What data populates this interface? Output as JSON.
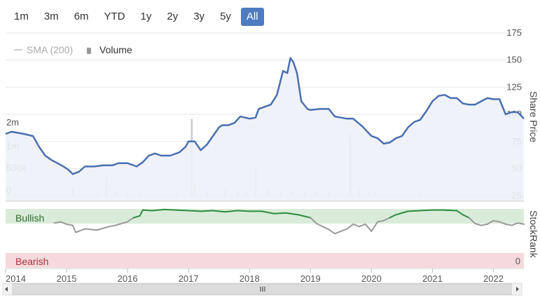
{
  "range_selector": {
    "buttons": [
      "1m",
      "3m",
      "6m",
      "YTD",
      "1y",
      "2y",
      "3y",
      "5y",
      "All"
    ],
    "active": "All"
  },
  "legend": {
    "sma_label": "SMA (200)",
    "volume_label": "Volume"
  },
  "colors": {
    "price_line": "#4a6fb0",
    "price_fill": "#eef1f8",
    "volume_bar": "#c9c9c9",
    "bullish_band": "#d9ecd9",
    "bearish_band": "#f5d9dc",
    "stockrank_green": "#2e8b3e",
    "stockrank_grey": "#9a9a9a",
    "active_button": "#4f7cc0"
  },
  "chart_data": {
    "type": "line",
    "x_axis": {
      "ticks": [
        "2014",
        "2015",
        "2016",
        "2017",
        "2018",
        "2019",
        "2020",
        "2021",
        "2022"
      ],
      "range": [
        2014.0,
        2022.5
      ]
    },
    "price_axis": {
      "label": "Share Price",
      "ticks": [
        25,
        50,
        75,
        100,
        125,
        150,
        175
      ],
      "range": [
        20,
        175
      ]
    },
    "volume_axis": {
      "ticks": [
        "0",
        "500k",
        "1m",
        "2m"
      ]
    },
    "stockrank_axis": {
      "label": "StockRank",
      "ticks": [
        "0"
      ]
    },
    "bands": {
      "bullish_label": "Bullish",
      "bearish_label": "Bearish"
    },
    "series": [
      {
        "kind": "price",
        "x": [
          2014.0,
          2014.1,
          2014.2,
          2014.3,
          2014.45,
          2014.55,
          2014.65,
          2014.75,
          2014.85,
          2014.95,
          2015.0,
          2015.05,
          2015.1,
          2015.2,
          2015.3,
          2015.45,
          2015.6,
          2015.75,
          2015.85,
          2016.0,
          2016.15,
          2016.25,
          2016.35,
          2016.45,
          2016.55,
          2016.7,
          2016.85,
          2016.95,
          2017.0,
          2017.1,
          2017.2,
          2017.3,
          2017.4,
          2017.5,
          2017.55,
          2017.65,
          2017.75,
          2017.85,
          2018.0,
          2018.1,
          2018.15,
          2018.25,
          2018.35,
          2018.45,
          2018.55,
          2018.62,
          2018.67,
          2018.72,
          2018.78,
          2018.85,
          2018.95,
          2019.0,
          2019.15,
          2019.3,
          2019.4,
          2019.5,
          2019.6,
          2019.7,
          2019.85,
          2020.0,
          2020.1,
          2020.2,
          2020.3,
          2020.4,
          2020.5,
          2020.6,
          2020.7,
          2020.8,
          2020.9,
          2021.0,
          2021.1,
          2021.2,
          2021.3,
          2021.4,
          2021.5,
          2021.6,
          2021.7,
          2021.8,
          2021.9,
          2022.0,
          2022.1,
          2022.2,
          2022.3,
          2022.4,
          2022.5
        ],
        "y": [
          82,
          84,
          83,
          82,
          80,
          70,
          62,
          58,
          55,
          52,
          50,
          48,
          45,
          47,
          52,
          52,
          53,
          53,
          55,
          55,
          52,
          56,
          62,
          64,
          62,
          62,
          65,
          70,
          75,
          75,
          67,
          72,
          80,
          88,
          90,
          90,
          92,
          98,
          96,
          97,
          105,
          107,
          109,
          118,
          140,
          138,
          152,
          148,
          138,
          112,
          105,
          104,
          105,
          105,
          98,
          97,
          96,
          96,
          89,
          80,
          78,
          73,
          74,
          78,
          80,
          88,
          93,
          95,
          103,
          112,
          117,
          118,
          115,
          115,
          110,
          109,
          109,
          112,
          115,
          114,
          114,
          100,
          102,
          102,
          96
        ]
      },
      {
        "kind": "volume",
        "x": [
          2014.05,
          2014.15,
          2014.3,
          2014.5,
          2014.7,
          2014.9,
          2015.1,
          2015.3,
          2015.5,
          2015.65,
          2015.8,
          2016.0,
          2016.2,
          2016.5,
          2016.8,
          2017.05,
          2017.1,
          2017.3,
          2017.6,
          2017.8,
          2017.95,
          2018.1,
          2018.3,
          2018.5,
          2018.7,
          2018.9,
          2019.1,
          2019.3,
          2019.5,
          2019.65,
          2019.8,
          2019.95,
          2020.05,
          2020.2,
          2020.4,
          2020.6,
          2020.8,
          2021.0,
          2021.2,
          2021.5,
          2021.8,
          2022.0,
          2022.2,
          2022.4
        ],
        "y": [
          120000,
          80000,
          60000,
          40000,
          50000,
          40000,
          250000,
          60000,
          80000,
          500000,
          120000,
          100000,
          80000,
          60000,
          90000,
          2100000,
          300000,
          150000,
          200000,
          120000,
          100000,
          700000,
          200000,
          150000,
          160000,
          120000,
          150000,
          100000,
          80000,
          1700000,
          200000,
          100000,
          120000,
          60000,
          50000,
          40000,
          70000,
          60000,
          50000,
          40000,
          50000,
          40000,
          60000,
          30000
        ]
      },
      {
        "kind": "stockrank",
        "x": [
          2014.8,
          2014.9,
          2015.0,
          2015.1,
          2015.15,
          2015.2,
          2015.3,
          2015.4,
          2015.5,
          2015.6,
          2015.7,
          2015.8,
          2015.9,
          2016.0,
          2016.05,
          2016.1,
          2016.2,
          2016.25,
          2016.4,
          2016.6,
          2016.8,
          2017.0,
          2017.2,
          2017.4,
          2017.6,
          2017.8,
          2018.0,
          2018.2,
          2018.4,
          2018.6,
          2018.8,
          2019.0,
          2019.1,
          2019.2,
          2019.3,
          2019.4,
          2019.5,
          2019.6,
          2019.7,
          2019.8,
          2019.9,
          2020.0,
          2020.1,
          2020.2,
          2020.3,
          2020.4,
          2020.5,
          2020.6,
          2020.8,
          2021.0,
          2021.2,
          2021.4,
          2021.5,
          2021.6,
          2021.7,
          2021.8,
          2021.9,
          2022.0,
          2022.1,
          2022.2,
          2022.3,
          2022.4,
          2022.5
        ],
        "y": [
          76,
          78,
          74,
          72,
          60,
          62,
          66,
          65,
          64,
          67,
          70,
          72,
          75,
          78,
          82,
          85,
          88,
          98,
          97,
          99,
          98,
          97,
          96,
          97,
          95,
          97,
          96,
          96,
          92,
          93,
          90,
          85,
          75,
          70,
          65,
          58,
          62,
          66,
          74,
          70,
          74,
          62,
          78,
          80,
          85,
          90,
          93,
          96,
          97,
          98,
          98,
          97,
          90,
          85,
          75,
          72,
          74,
          80,
          78,
          74,
          72,
          76,
          74
        ]
      }
    ]
  }
}
